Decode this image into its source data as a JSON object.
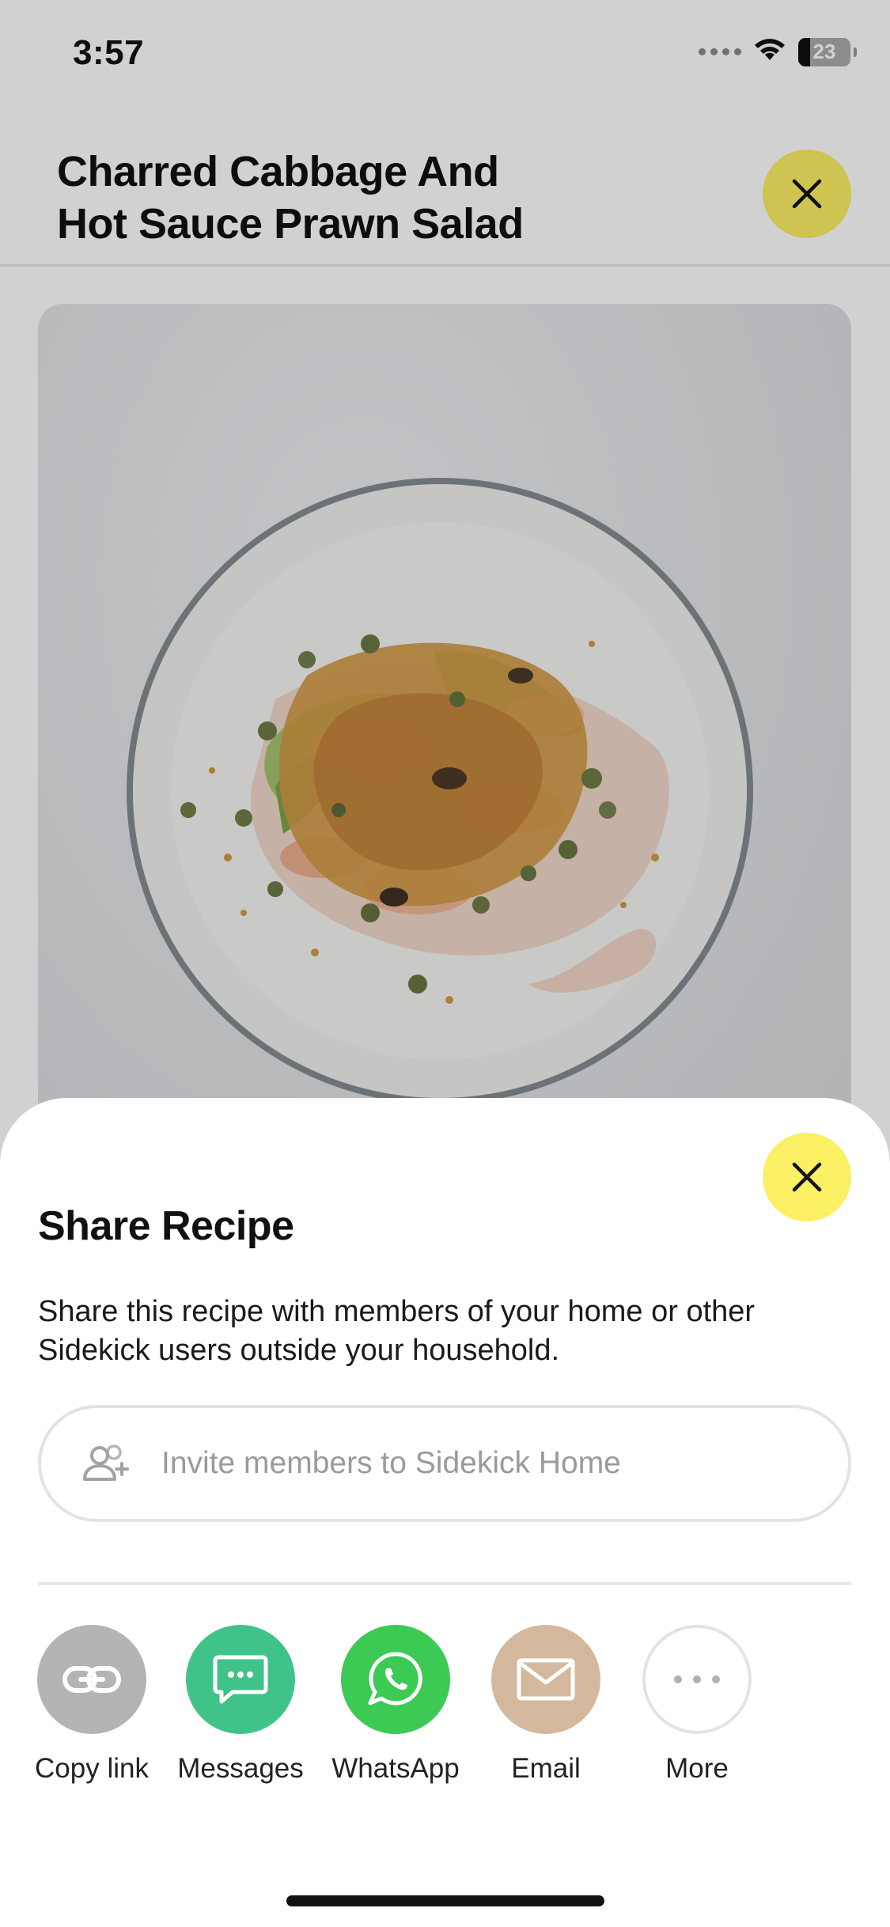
{
  "status_bar": {
    "time": "3:57",
    "battery": "23",
    "battery_level_fraction": 0.23
  },
  "recipe": {
    "title": "Charred Cabbage And Hot Sauce Prawn Salad",
    "close_icon": "close-icon",
    "photo_subject": "plated-salad-image"
  },
  "share_sheet": {
    "title": "Share Recipe",
    "description": "Share this recipe with members of your home or other Sidekick users outside your household.",
    "invite_placeholder": "Invite members to Sidekick Home",
    "invite_icon": "add-user-icon",
    "close_icon": "close-icon",
    "options": [
      {
        "label": "Copy link",
        "icon": "link-icon",
        "color": "#b4b4b4"
      },
      {
        "label": "Messages",
        "icon": "message-bubble-icon",
        "color": "#3fc388"
      },
      {
        "label": "WhatsApp",
        "icon": "whatsapp-icon",
        "color": "#3cc954"
      },
      {
        "label": "Email",
        "icon": "envelope-icon",
        "color": "#d4b89e"
      },
      {
        "label": "More",
        "icon": "more-dots-icon",
        "color": "#ffffff"
      }
    ]
  },
  "colors": {
    "accent_yellow": "#fbef63",
    "divider": "#e6e6e6",
    "placeholder_text": "#9a9a9a"
  }
}
